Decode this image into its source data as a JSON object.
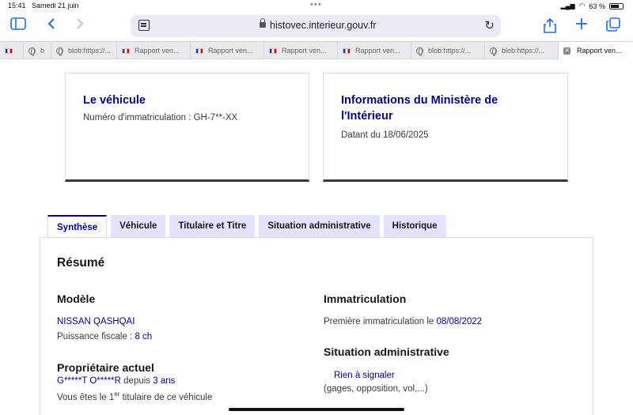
{
  "status": {
    "time": "15:41",
    "date": "Samedi 21 juin",
    "battery": "63 %"
  },
  "browser": {
    "url": "histovec.interieur.gouv.fr",
    "tabs": [
      {
        "label": "",
        "icon": "flag-icon"
      },
      {
        "label": "b",
        "icon": "globe-icon"
      },
      {
        "label": "blob:https://...",
        "icon": "globe-icon"
      },
      {
        "label": "Rapport ven...",
        "icon": "flag-icon"
      },
      {
        "label": "Rapport ven...",
        "icon": "flag-icon"
      },
      {
        "label": "Rapport ven...",
        "icon": "flag-icon"
      },
      {
        "label": "Rapport ven...",
        "icon": "flag-icon"
      },
      {
        "label": "blob:https://...",
        "icon": "globe-icon"
      },
      {
        "label": "blob:https://...",
        "icon": "globe-icon"
      },
      {
        "label": "Rapport ven...",
        "icon": "close-icon",
        "active": true
      }
    ]
  },
  "cards": {
    "vehicle": {
      "title": "Le véhicule",
      "subtitle": "Numéro d'immatriculation : GH-7**-XX"
    },
    "ministry": {
      "title": "Informations du Ministère de l'Intérieur",
      "subtitle": "Datant du 18/06/2025"
    }
  },
  "section_tabs": [
    "Synthèse",
    "Véhicule",
    "Titulaire et Titre",
    "Situation administrative",
    "Historique"
  ],
  "summary": {
    "title": "Résumé",
    "model": {
      "heading": "Modèle",
      "name": "NISSAN QASHQAI",
      "power_label": "Puissance fiscale : ",
      "power_value": "8 ch"
    },
    "owner": {
      "heading": "Propriétaire actuel",
      "name": "G*****T O*****R",
      "since_label": " depuis ",
      "since_value": "3 ans",
      "note_pre": "Vous êtes le 1",
      "note_sup": "er",
      "note_post": " titulaire de ce véhicule"
    },
    "registration": {
      "heading": "Immatriculation",
      "first_label": "Première immatriculation le ",
      "first_value": "08/08/2022"
    },
    "admin": {
      "heading": "Situation administrative",
      "status": "Rien à signaler",
      "note": "(gages, opposition, vol,...)"
    }
  }
}
